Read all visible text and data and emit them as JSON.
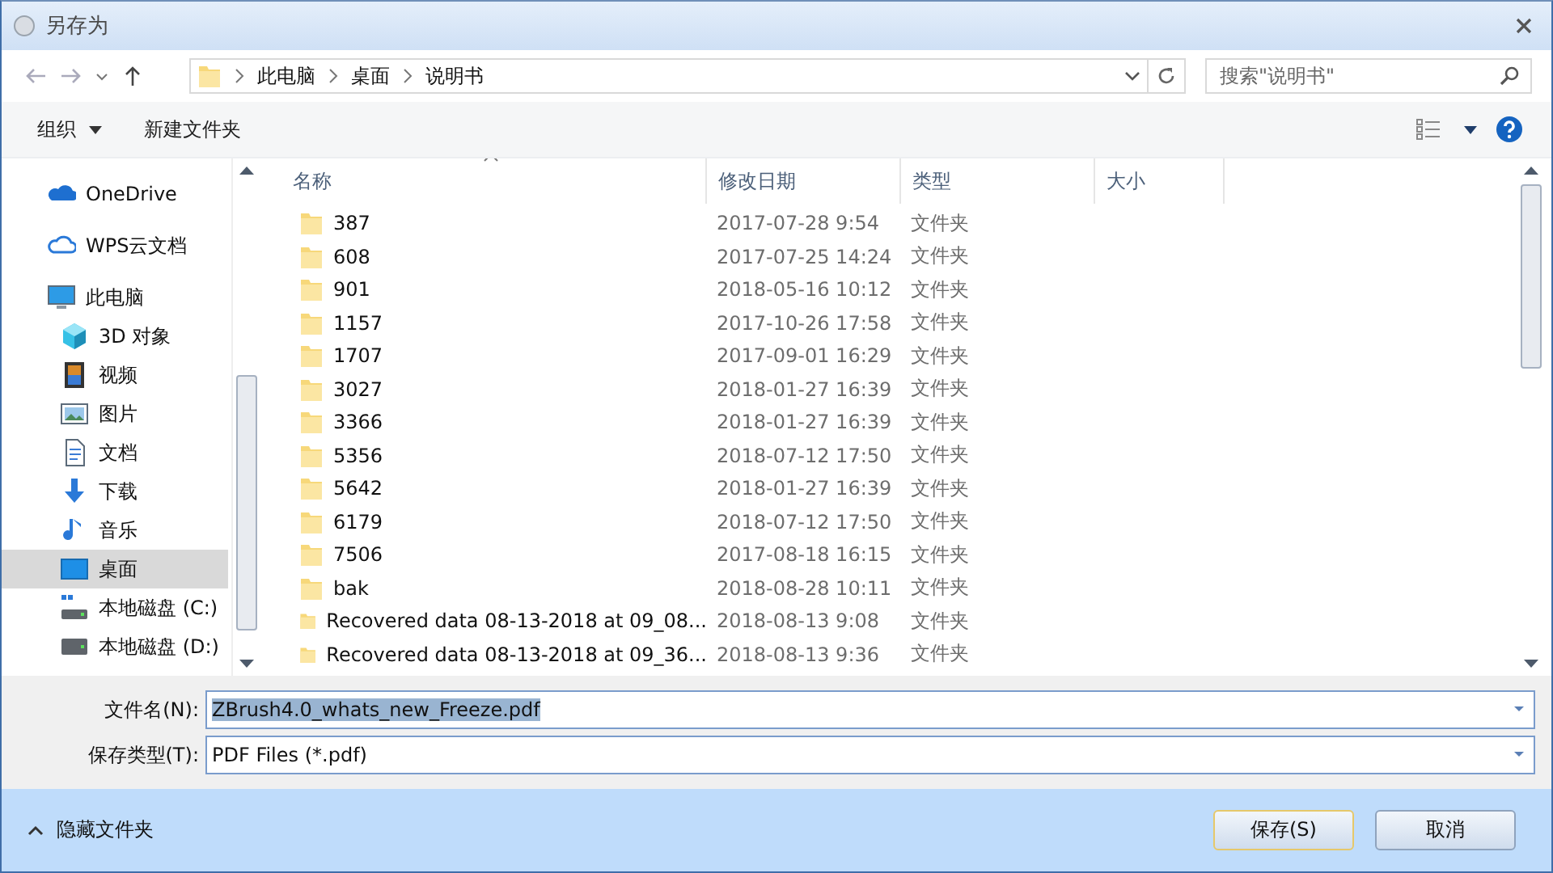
{
  "window": {
    "title": "另存为"
  },
  "address": {
    "path": [
      "此电脑",
      "桌面",
      "说明书"
    ]
  },
  "search": {
    "placeholder": "搜索\"说明书\""
  },
  "toolbar": {
    "organize": "组织",
    "new_folder": "新建文件夹"
  },
  "sidebar": {
    "items": [
      {
        "label": "OneDrive",
        "kind": "onedrive",
        "selected": false
      },
      {
        "label": "WPS云文档",
        "kind": "cloud",
        "selected": false
      },
      {
        "label": "此电脑",
        "kind": "pc",
        "selected": false,
        "children": [
          {
            "label": "3D 对象",
            "kind": "cube",
            "selected": false
          },
          {
            "label": "视频",
            "kind": "video",
            "selected": false
          },
          {
            "label": "图片",
            "kind": "picture",
            "selected": false
          },
          {
            "label": "文档",
            "kind": "document",
            "selected": false
          },
          {
            "label": "下载",
            "kind": "download",
            "selected": false
          },
          {
            "label": "音乐",
            "kind": "music",
            "selected": false
          },
          {
            "label": "桌面",
            "kind": "desktop",
            "selected": true
          },
          {
            "label": "本地磁盘 (C:)",
            "kind": "system-drive",
            "selected": false
          },
          {
            "label": "本地磁盘 (D:)",
            "kind": "drive",
            "selected": false
          }
        ]
      }
    ]
  },
  "table": {
    "columns": [
      {
        "label": "名称",
        "sorted": true
      },
      {
        "label": "修改日期",
        "sorted": false
      },
      {
        "label": "类型",
        "sorted": false
      },
      {
        "label": "大小",
        "sorted": false
      }
    ],
    "rows": [
      {
        "name": "387",
        "date": "2017-07-28 9:54",
        "type": "文件夹"
      },
      {
        "name": "608",
        "date": "2017-07-25 14:24",
        "type": "文件夹"
      },
      {
        "name": "901",
        "date": "2018-05-16 10:12",
        "type": "文件夹"
      },
      {
        "name": "1157",
        "date": "2017-10-26 17:58",
        "type": "文件夹"
      },
      {
        "name": "1707",
        "date": "2017-09-01 16:29",
        "type": "文件夹"
      },
      {
        "name": "3027",
        "date": "2018-01-27 16:39",
        "type": "文件夹"
      },
      {
        "name": "3366",
        "date": "2018-01-27 16:39",
        "type": "文件夹"
      },
      {
        "name": "5356",
        "date": "2018-07-12 17:50",
        "type": "文件夹"
      },
      {
        "name": "5642",
        "date": "2018-01-27 16:39",
        "type": "文件夹"
      },
      {
        "name": "6179",
        "date": "2018-07-12 17:50",
        "type": "文件夹"
      },
      {
        "name": "7506",
        "date": "2017-08-18 16:15",
        "type": "文件夹"
      },
      {
        "name": "bak",
        "date": "2018-08-28 10:11",
        "type": "文件夹"
      },
      {
        "name": "Recovered data 08-13-2018 at 09_08...",
        "date": "2018-08-13 9:08",
        "type": "文件夹"
      },
      {
        "name": "Recovered data 08-13-2018 at 09_36...",
        "date": "2018-08-13 9:36",
        "type": "文件夹"
      }
    ]
  },
  "file_name": {
    "label": "文件名(N):",
    "value": "ZBrush4.0_whats_new_Freeze.pdf",
    "selected": true
  },
  "file_type": {
    "label": "保存类型(T):",
    "value": "PDF Files (*.pdf)"
  },
  "hide_folders": "隐藏文件夹",
  "buttons": [
    {
      "label": "保存(S)",
      "default": true
    },
    {
      "label": "取消",
      "default": false
    }
  ]
}
